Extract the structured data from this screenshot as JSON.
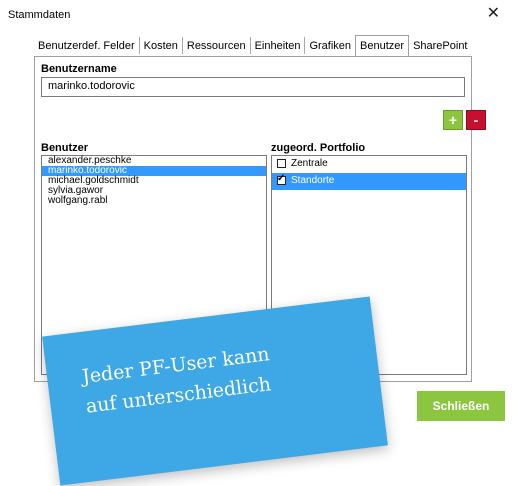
{
  "window": {
    "title": "Stammdaten"
  },
  "tabs": [
    {
      "label": "Benutzerdef. Felder"
    },
    {
      "label": "Kosten"
    },
    {
      "label": "Ressourcen"
    },
    {
      "label": "Einheiten"
    },
    {
      "label": "Grafiken"
    },
    {
      "label": "Benutzer",
      "active": true
    },
    {
      "label": "SharePoint"
    }
  ],
  "username": {
    "label": "Benutzername",
    "value": "marinko.todorovic"
  },
  "buttons": {
    "add": "+",
    "remove": "-",
    "close": "Schließen"
  },
  "users": {
    "label": "Benutzer",
    "items": [
      {
        "name": "alexander.peschke"
      },
      {
        "name": "marinko.todorovic",
        "selected": true
      },
      {
        "name": "michael.goldschmidt"
      },
      {
        "name": "sylvia.gawor"
      },
      {
        "name": "wolfgang.rabl"
      }
    ]
  },
  "portfolio": {
    "label": "zugeord. Portfolio",
    "items": [
      {
        "name": "Zentrale",
        "checked": false
      },
      {
        "name": "Standorte",
        "checked": true,
        "selected": true
      }
    ]
  },
  "note": {
    "line1": "Jeder PF-User kann",
    "line2": "auf unterschiedlich"
  },
  "colors": {
    "accent_green": "#8cc63f",
    "delete_red": "#c8102e",
    "selection_blue": "#3399ff",
    "note_blue": "#3ea7e6"
  }
}
